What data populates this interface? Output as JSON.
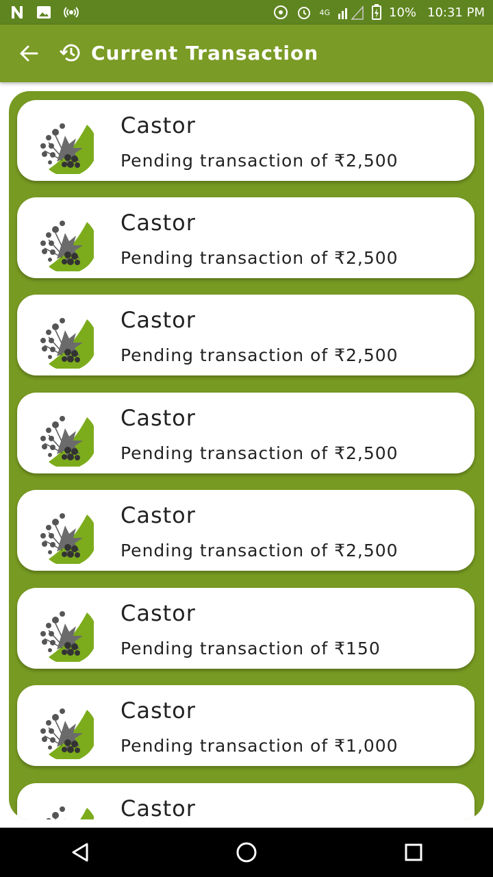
{
  "status_bar": {
    "battery": "10%",
    "time": "10:31 PM",
    "network": "4G",
    "icons": [
      "n-icon",
      "image-icon",
      "hotspot-icon",
      "wifi-calling-icon",
      "alarm-icon",
      "signal-icon",
      "battery-icon"
    ]
  },
  "app_bar": {
    "title": "Current Transaction",
    "back_icon": "back-arrow-icon",
    "history_icon": "history-icon"
  },
  "transactions": [
    {
      "name": "Castor",
      "status": "Pending transaction of ₹2,500"
    },
    {
      "name": "Castor",
      "status": "Pending transaction of ₹2,500"
    },
    {
      "name": "Castor",
      "status": "Pending transaction of ₹2,500"
    },
    {
      "name": "Castor",
      "status": "Pending transaction of ₹2,500"
    },
    {
      "name": "Castor",
      "status": "Pending transaction of ₹2,500"
    },
    {
      "name": "Castor",
      "status": "Pending transaction of ₹150"
    },
    {
      "name": "Castor",
      "status": "Pending transaction of ₹1,000"
    },
    {
      "name": "Castor",
      "status": ""
    }
  ],
  "colors": {
    "status_bar": "#5f8520",
    "app_bar": "#7a9b25",
    "list_background": "#779a22",
    "thumb_accent": "#7cac1c"
  },
  "nav_bar": [
    "back-triangle-icon",
    "home-circle-icon",
    "recents-square-icon"
  ]
}
